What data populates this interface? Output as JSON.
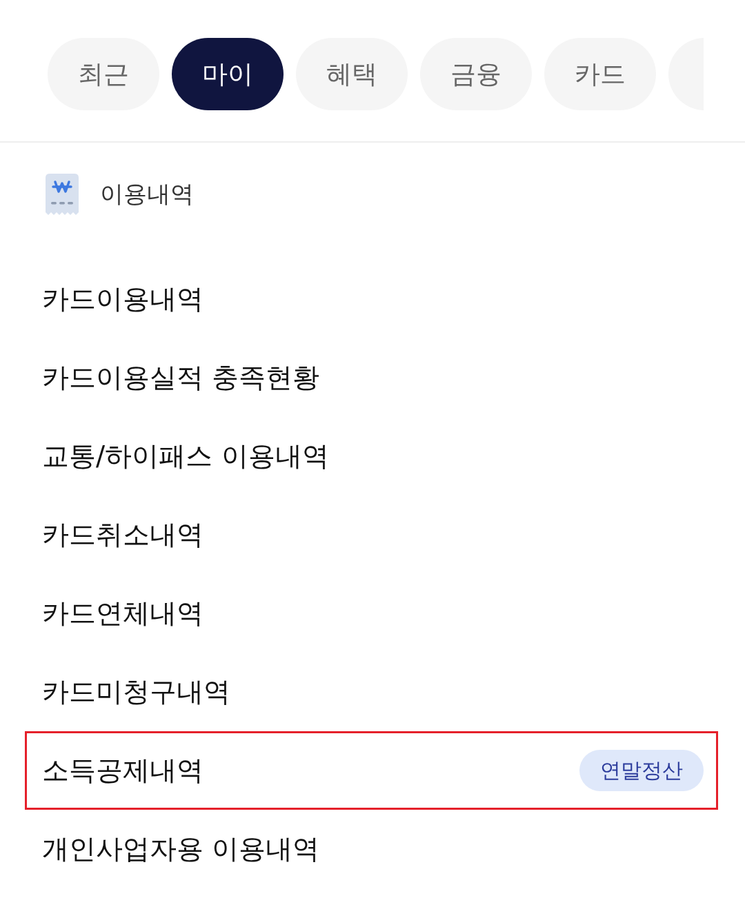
{
  "tabs": [
    {
      "label": "최근",
      "selected": false
    },
    {
      "label": "마이",
      "selected": true
    },
    {
      "label": "혜택",
      "selected": false
    },
    {
      "label": "금융",
      "selected": false
    },
    {
      "label": "카드",
      "selected": false
    },
    {
      "selected": false
    }
  ],
  "section": {
    "title": "이용내역"
  },
  "items": [
    {
      "label": "카드이용내역",
      "highlighted": false
    },
    {
      "label": "카드이용실적 충족현황",
      "highlighted": false
    },
    {
      "label": "교통/하이패스 이용내역",
      "highlighted": false
    },
    {
      "label": "카드취소내역",
      "highlighted": false
    },
    {
      "label": "카드연체내역",
      "highlighted": false
    },
    {
      "label": "카드미청구내역",
      "highlighted": false
    },
    {
      "label": "소득공제내역",
      "badge": "연말정산",
      "highlighted": true
    },
    {
      "label": "개인사업자용 이용내역",
      "highlighted": false
    }
  ]
}
